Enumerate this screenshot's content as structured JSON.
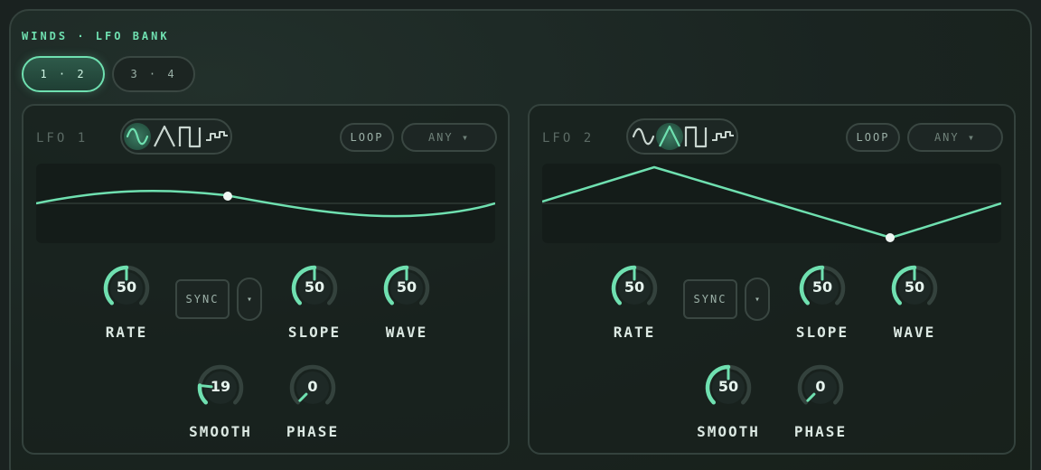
{
  "header": {
    "title": "WINDS · LFO BANK",
    "tabs": [
      {
        "label": "1 · 2",
        "active": true
      },
      {
        "label": "3 · 4",
        "active": false
      }
    ]
  },
  "colors": {
    "accent": "#6fe0b0",
    "background": "#1a2220",
    "panel_border": "#34423d"
  },
  "icons": {
    "wave_types": [
      "sine-wave-icon",
      "triangle-wave-icon",
      "square-wave-icon",
      "step-wave-icon"
    ]
  },
  "lfos": [
    {
      "name": "LFO 1",
      "selected_wave": "sine",
      "loop_label": "LOOP",
      "trigger_label": "ANY ▾",
      "sync_label": "SYNC",
      "sync_dropdown": "▾",
      "knobs": {
        "rate": {
          "label": "RATE",
          "value": "50",
          "level": 0.5
        },
        "slope": {
          "label": "SLOPE",
          "value": "50",
          "level": 0.5
        },
        "wave": {
          "label": "WAVE",
          "value": "50",
          "level": 0.5
        },
        "smooth": {
          "label": "SMOOTH",
          "value": "19",
          "level": 0.19
        },
        "phase": {
          "label": "PHASE",
          "value": "0",
          "level": 0
        }
      }
    },
    {
      "name": "LFO 2",
      "selected_wave": "triangle",
      "loop_label": "LOOP",
      "trigger_label": "ANY ▾",
      "sync_label": "SYNC",
      "sync_dropdown": "▾",
      "knobs": {
        "rate": {
          "label": "RATE",
          "value": "50",
          "level": 0.5
        },
        "slope": {
          "label": "SLOPE",
          "value": "50",
          "level": 0.5
        },
        "wave": {
          "label": "WAVE",
          "value": "50",
          "level": 0.5
        },
        "smooth": {
          "label": "SMOOTH",
          "value": "50",
          "level": 0.5
        },
        "phase": {
          "label": "PHASE",
          "value": "0",
          "level": 0
        }
      }
    }
  ]
}
